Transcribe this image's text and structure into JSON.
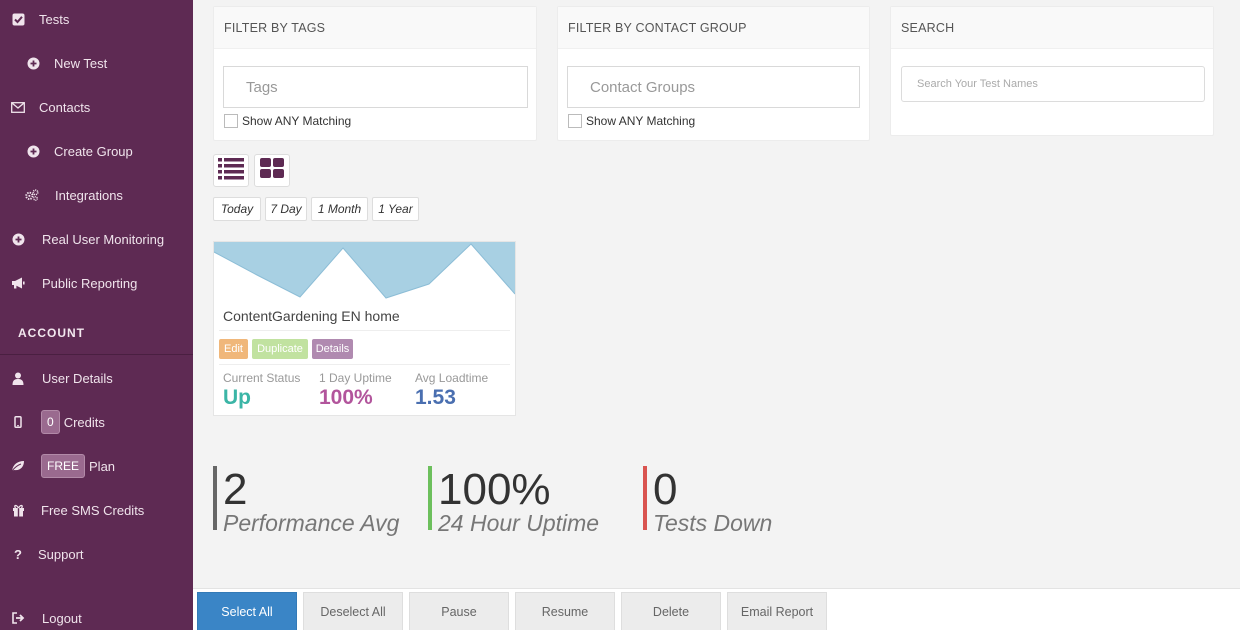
{
  "sidebar": {
    "items": [
      {
        "label": "Tests",
        "icon": "check-square-icon"
      },
      {
        "label": "New Test",
        "icon": "plus-circle-icon"
      },
      {
        "label": "Contacts",
        "icon": "envelope-icon"
      },
      {
        "label": "Create Group",
        "icon": "plus-circle-icon"
      },
      {
        "label": "Integrations",
        "icon": "gears-icon"
      },
      {
        "label": "Real User Monitoring",
        "icon": "plus-circle-icon"
      },
      {
        "label": "Public Reporting",
        "icon": "bullhorn-icon"
      }
    ],
    "account_label": "ACCOUNT",
    "account_items": [
      {
        "label": "User Details",
        "icon": "user-icon"
      },
      {
        "label": "Credits",
        "icon": "mobile-icon",
        "badge": "0"
      },
      {
        "label": "Plan",
        "icon": "leaf-icon",
        "badge": "FREE"
      },
      {
        "label": "Free SMS Credits",
        "icon": "gift-icon"
      },
      {
        "label": "Support",
        "icon": "question-icon"
      },
      {
        "label": "Logout",
        "icon": "sign-out-icon"
      }
    ]
  },
  "filters": {
    "tags": {
      "title": "FILTER BY TAGS",
      "placeholder": "Tags",
      "checkbox": "Show ANY Matching"
    },
    "groups": {
      "title": "FILTER BY CONTACT GROUP",
      "placeholder": "Contact Groups",
      "checkbox": "Show ANY Matching"
    },
    "search": {
      "title": "SEARCH",
      "placeholder": "Search Your Test Names"
    }
  },
  "ranges": [
    "Today",
    "7 Day",
    "1 Month",
    "1 Year"
  ],
  "card": {
    "title": "ContentGardening EN home",
    "buttons": {
      "edit": "Edit",
      "duplicate": "Duplicate",
      "details": "Details"
    },
    "stats": {
      "status_label": "Current Status",
      "status_value": "Up",
      "uptime_label": "1 Day Uptime",
      "uptime_value": "100%",
      "load_label": "Avg Loadtime",
      "load_value": "1.53"
    }
  },
  "summary": {
    "perf": {
      "value": "2",
      "label": "Performance Avg"
    },
    "uptime": {
      "value": "100%",
      "label": "24 Hour Uptime"
    },
    "down": {
      "value": "0",
      "label": "Tests Down"
    }
  },
  "actions": {
    "select_all": "Select All",
    "deselect_all": "Deselect All",
    "pause": "Pause",
    "resume": "Resume",
    "delete": "Delete",
    "email_report": "Email Report"
  },
  "colors": {
    "sidebar": "#5e2a53",
    "status_up": "#3bb5a6",
    "uptime": "#b2559c",
    "loadtime": "#4a6fb0",
    "edit": "#f0b77a",
    "duplicate": "#c1e2a0",
    "details": "#b08ab0",
    "chart_fill": "#a8d0e3"
  }
}
